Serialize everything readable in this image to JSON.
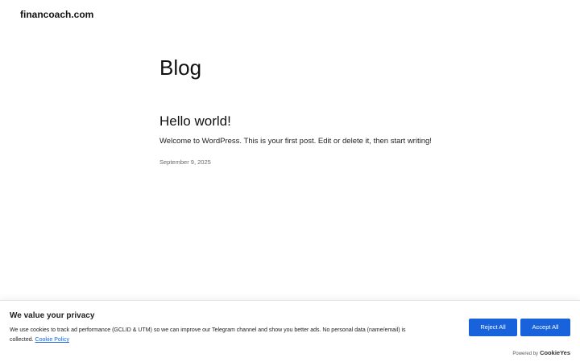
{
  "site": {
    "title": "financoach.com"
  },
  "main": {
    "heading": "Blog",
    "posts": [
      {
        "title": "Hello world!",
        "excerpt": "Welcome to WordPress. This is your first post. Edit or delete it, then start writing!",
        "date": "September 9, 2025"
      }
    ]
  },
  "cookie_banner": {
    "title": "We value your privacy",
    "text": "We use cookies to track ad performance (GCLID & UTM) so we can improve our Telegram channel and show you better ads. No personal data (name/email) is collected.",
    "policy_link": "Cookie Policy",
    "reject_label": "Reject All",
    "accept_label": "Accept All",
    "powered_by": "Powered by",
    "brand": "CookieYes",
    "accent_color": "#1863dc"
  }
}
